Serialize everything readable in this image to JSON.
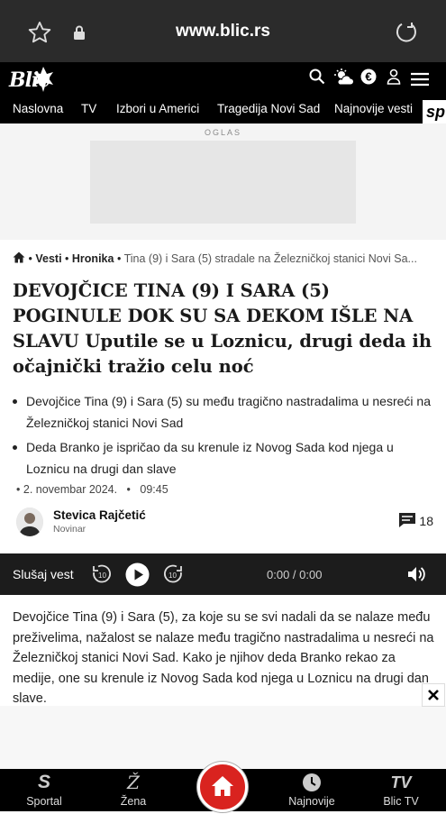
{
  "browser": {
    "url": "www.blic.rs"
  },
  "header": {
    "logo": "Blic",
    "nav": [
      "Naslovna",
      "TV",
      "Izbori u Americi",
      "Tragedija Novi Sad",
      "Najnovije vesti"
    ],
    "sp_tab": "sp"
  },
  "ad": {
    "label": "OGLAS"
  },
  "breadcrumb": {
    "sep": "•",
    "items": [
      "Vesti",
      "Hronika"
    ],
    "current": "Tina (9) i Sara (5) stradale na Železničkoj stanici Novi Sa..."
  },
  "article": {
    "title": "DEVOJČICE TINA (9) I SARA (5) POGINULE DOK SU SA DEKOM IŠLE NA SLAVU Uputile se u Loznicu, drugi deda ih očajnički tražio celu noć",
    "bullets": [
      "Devojčice Tina (9) i Sara (5) su među tragično nastradalima u nesreći na Železničkoj stanici Novi Sad",
      "Deda Branko je ispričao da su krenule iz Novog Sada kod njega u Loznicu na drugi dan slave"
    ],
    "date": "2. novembar 2024.",
    "time": "09:45",
    "author": "Stevica Rajčetić",
    "author_role": "Novinar",
    "comments": "18",
    "body": "Devojčice Tina (9) i Sara (5), za koje su se svi nadali da se nalaze među preživelima, nažalost se nalaze među tragično nastradalima u nesreći na Železničkoj stanici Novi Sad. Kako je njihov deda Branko rekao za medije, one su krenule iz Novog Sada kod njega u Loznicu na drugi dan slave."
  },
  "player": {
    "label": "Slušaj vest",
    "time": "0:00 / 0:00",
    "skip": "10"
  },
  "bottom_nav": {
    "sport": "Sportal",
    "sport_icon": "S",
    "zena": "Žena",
    "zena_icon": "Ž",
    "najnovije": "Najnovije",
    "blictv": "Blic TV",
    "blictv_icon": "TV"
  },
  "colors": {
    "accent": "#d9231f",
    "header_bg": "#000000"
  }
}
